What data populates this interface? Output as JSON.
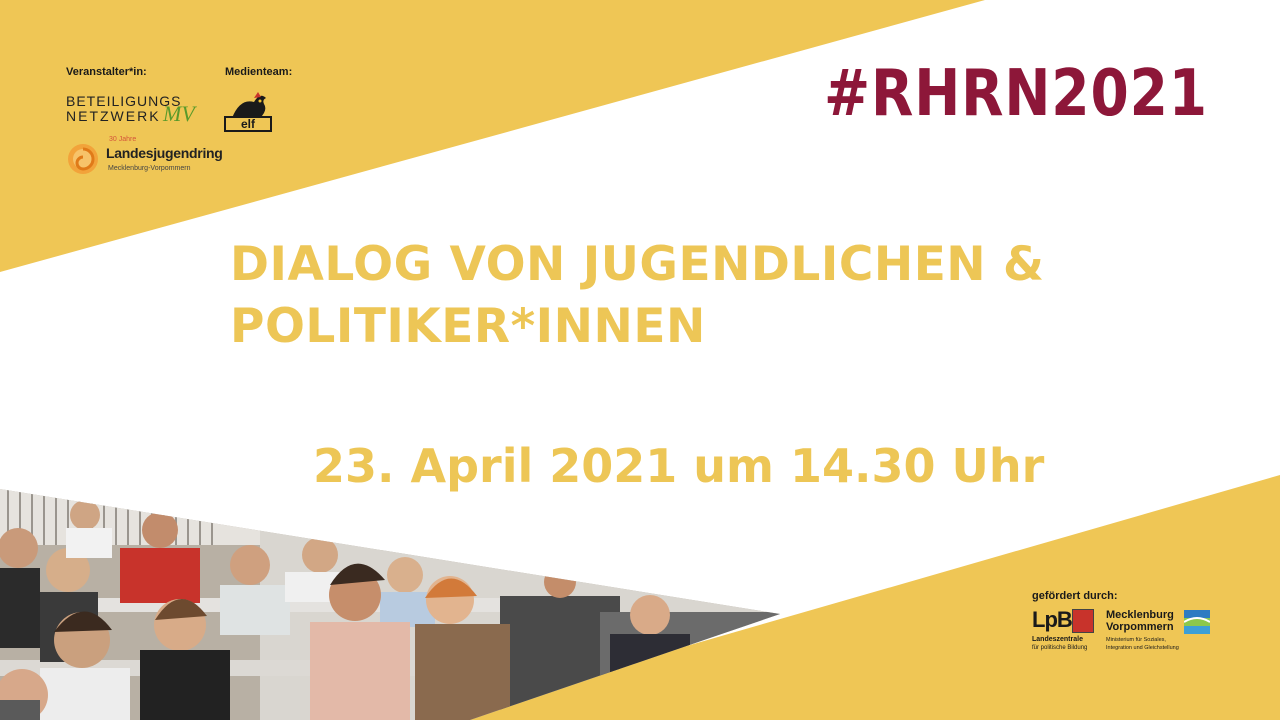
{
  "organizers_label": "Veranstalter*in:",
  "media_team_label": "Medienteam:",
  "logos": {
    "beteiligungsnetzwerk": {
      "line1": "BETEILIGUNGS",
      "line2": "NETZWERK",
      "mark": "MV"
    },
    "landesjugendring": {
      "badge": "30 Jahre",
      "name": "Landesjugendring",
      "region": "Mecklenburg-Vorpommern"
    },
    "medienteam": {
      "name": "elf"
    },
    "lpb": {
      "mark": "LpB",
      "line1": "Landeszentrale",
      "line2": "für politische Bildung"
    },
    "mv_ministry": {
      "line1": "Mecklenburg",
      "line2": "Vorpommern",
      "line3": "Ministerium für Soziales,",
      "line4": "Integration und Gleichstellung"
    }
  },
  "hashtag": "#RHRN2021",
  "headline": {
    "line1": "DIALOG VON JUGENDLICHEN &",
    "line2": "POLITIKER*INNEN"
  },
  "date_text": "23. April 2021 um 14.30 Uhr",
  "sponsor_label": "gefördert durch:",
  "colors": {
    "yellow": "#efc655",
    "crimson": "#8d1739",
    "headline": "#edc656"
  },
  "photo": {
    "subject": "seated young audience in a lecture hall"
  }
}
